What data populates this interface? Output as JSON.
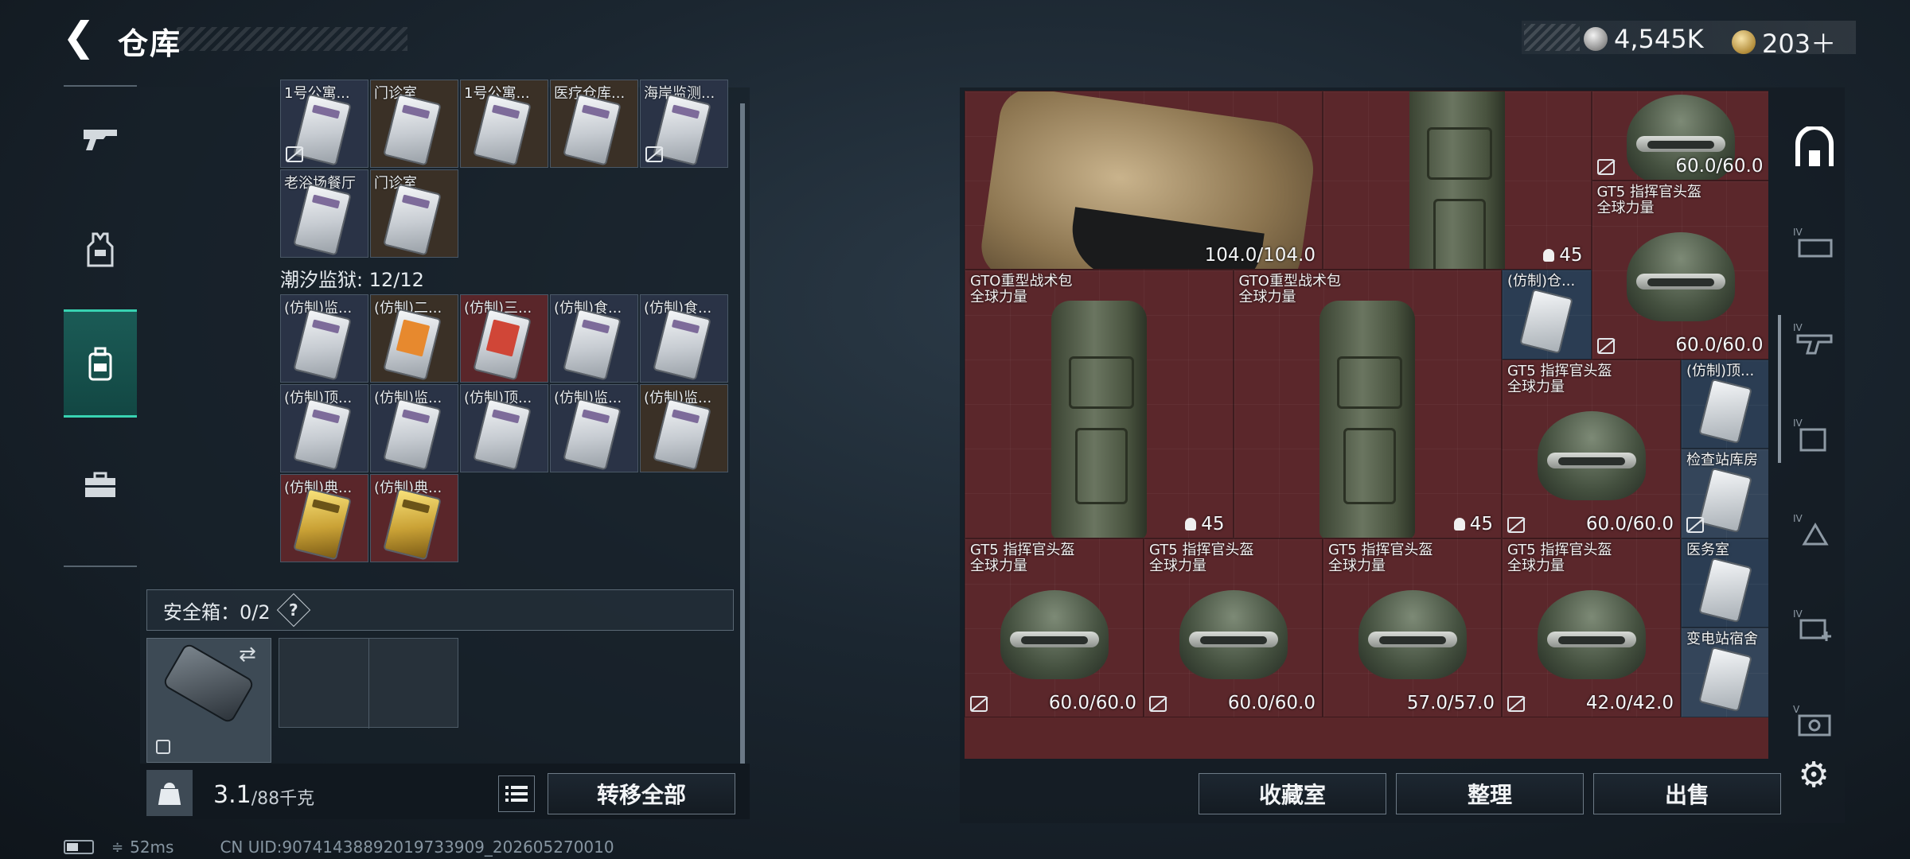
{
  "header": {
    "title": "仓库",
    "currency": [
      {
        "icon": "silver-coin-icon",
        "value": "4,545K"
      },
      {
        "icon": "gold-coin-icon",
        "value": "203＋"
      }
    ],
    "version": "      "
  },
  "left_nav": [
    {
      "icon": "gun-icon",
      "active": false
    },
    {
      "icon": "armor-vest-icon",
      "active": false
    },
    {
      "icon": "backpack-icon",
      "active": true
    },
    {
      "icon": "toolbox-icon",
      "active": false
    }
  ],
  "left_inventory": {
    "rows": [
      {
        "cells": [
          {
            "label": "1号公寓...",
            "color": "g",
            "locked": true
          },
          {
            "label": "门诊室",
            "color": "b"
          },
          {
            "label": "1号公寓...",
            "color": "b"
          },
          {
            "label": "医疗仓库...",
            "color": "b"
          },
          {
            "label": "海岸监测...",
            "color": "g",
            "locked": true
          }
        ]
      },
      {
        "cells": [
          {
            "label": "老浴场餐厅",
            "color": "g"
          },
          {
            "label": "门诊室",
            "color": "b"
          }
        ]
      }
    ],
    "section_title": "潮汐监狱: 12/12",
    "section_rows": [
      {
        "cells": [
          {
            "label": "(仿制)监...",
            "color": "g"
          },
          {
            "label": "(仿制)二...",
            "color": "b",
            "card": "orange"
          },
          {
            "label": "(仿制)三...",
            "color": "r",
            "card": "red"
          },
          {
            "label": "(仿制)食...",
            "color": "g"
          },
          {
            "label": "(仿制)食...",
            "color": "g"
          }
        ]
      },
      {
        "cells": [
          {
            "label": "(仿制)顶...",
            "color": "g"
          },
          {
            "label": "(仿制)监...",
            "color": "g"
          },
          {
            "label": "(仿制)顶...",
            "color": "g"
          },
          {
            "label": "(仿制)监...",
            "color": "g"
          },
          {
            "label": "(仿制)监...",
            "color": "b"
          }
        ]
      },
      {
        "cells": [
          {
            "label": "(仿制)典...",
            "color": "r",
            "card": "gold"
          },
          {
            "label": "(仿制)典...",
            "color": "r",
            "card": "gold"
          }
        ]
      }
    ]
  },
  "safebox": {
    "label": "安全箱：0/2",
    "help": "?"
  },
  "weight": {
    "current": "3.1",
    "max": "/88千克"
  },
  "left_footer": {
    "transfer_all": "转移全部"
  },
  "right_grid": {
    "items": [
      {
        "name": "",
        "durability": "104.0/104.0",
        "kind": "armor"
      },
      {
        "name": "",
        "capacity": "45",
        "kind": "pack"
      },
      {
        "name": "",
        "durability": "60.0/60.0",
        "kind": "helmet",
        "locked": true
      },
      {
        "name": "GT5 指挥官头盔\n全球力量",
        "durability": "60.0/60.0",
        "kind": "helmet",
        "locked": true
      },
      {
        "name": "GTO重型战术包\n全球力量",
        "capacity": "45",
        "kind": "pack"
      },
      {
        "name": "GTO重型战术包\n全球力量",
        "capacity": "45",
        "kind": "pack"
      },
      {
        "name": "(仿制)仓...",
        "kind": "card"
      },
      {
        "name": "GT5 指挥官头盔\n全球力量",
        "durability": "60.0/60.0",
        "kind": "helmet",
        "locked": true
      },
      {
        "name": "(仿制)顶...",
        "kind": "card"
      },
      {
        "name": "检查站库房",
        "kind": "card",
        "locked": true
      },
      {
        "name": "GT5 指挥官头盔\n全球力量",
        "durability": "60.0/60.0",
        "kind": "helmet",
        "locked": true
      },
      {
        "name": "GT5 指挥官头盔\n全球力量",
        "durability": "60.0/60.0",
        "kind": "helmet",
        "locked": true
      },
      {
        "name": "GT5 指挥官头盔\n全球力量",
        "durability": "57.0/57.0",
        "kind": "helmet"
      },
      {
        "name": "GT5 指挥官头盔\n全球力量",
        "durability": "42.0/42.0",
        "kind": "helmet",
        "locked": true
      },
      {
        "name": "医务室",
        "kind": "card"
      },
      {
        "name": "变电站宿舍",
        "kind": "card"
      }
    ]
  },
  "right_footer": {
    "collection": "收藏室",
    "sort": "整理",
    "sell": "出售"
  },
  "right_tabs": [
    {
      "icon": "stash-icon",
      "active": true
    },
    {
      "icon": "storage-tier-iv-icon"
    },
    {
      "icon": "storage-tier-iv-icon"
    },
    {
      "icon": "storage-tier-iv-icon"
    },
    {
      "icon": "storage-tier-iv-icon"
    },
    {
      "icon": "storage-tier-iv-add-icon"
    },
    {
      "icon": "storage-tier-v-icon"
    }
  ],
  "settings_icon": "gear-icon",
  "status": {
    "ping": "52ms",
    "uid": "CN UID:9074143889201973390­9_202605270010"
  }
}
